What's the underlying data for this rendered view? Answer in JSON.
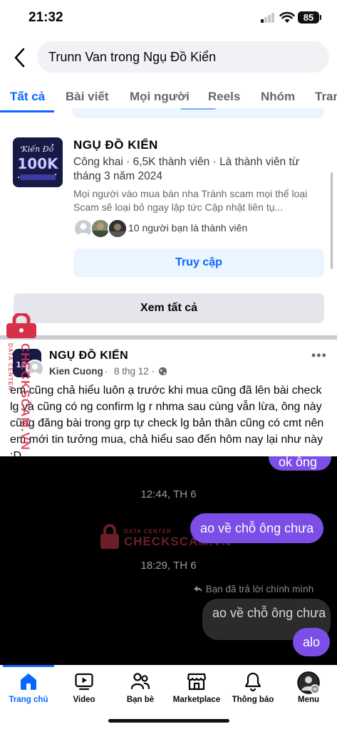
{
  "status_bar": {
    "time": "21:32",
    "battery": "85"
  },
  "search": {
    "query": "Trunn Van trong Ngụ Đồ Kiển"
  },
  "tabs": [
    {
      "label": "Tất cả",
      "active": true
    },
    {
      "label": "Bài viết"
    },
    {
      "label": "Mọi người"
    },
    {
      "label": "Reels"
    },
    {
      "label": "Nhóm"
    },
    {
      "label": "Tran"
    }
  ],
  "group": {
    "thumb_text": "100K",
    "name": "NGỤ ĐỒ KIỂN",
    "meta": "Công khai · 6,5K thành viên · Là thành viên từ tháng 3 năm 2024",
    "description": "Mọi người vào mua bán nha Tránh scam mọi thể loại Scam sẽ loại bỏ ngay lập tức Cập nhật liên tụ...",
    "friends_text": "10 người bạn là thành viên",
    "visit_label": "Truy cập"
  },
  "see_all_label": "Xem tất cả",
  "post": {
    "group_name": "NGỤ ĐỒ KIỂN",
    "author": "Kien Cuong",
    "separator": "·",
    "time": "8 thg 12 ·",
    "text": "em cũng chả hiểu luôn ạ trước khi mua cũng đã lên bài check lg và cũng có ng confirm lg r nhma sau cùng vẫn lừa, ông này cũng đăng bài trong grp tự check lg bản thân cũng có cmt nên em mới tin tưởng mua, chả hiểu sao đến hôm nay lại như này :D"
  },
  "chat": {
    "top_bubble": "ok ông",
    "time_1": "12:44, TH 6",
    "sent_bubble": "ao về chỗ ông chưa",
    "time_2": "18:29, TH 6",
    "reply_note": "Bạn đã trả lời chính mình",
    "quoted_bubble": "ao về chỗ ông chưa",
    "last_bubble": "alo"
  },
  "watermark": {
    "small": "DATA CENTER",
    "big": "CHECKSCAM.VN"
  },
  "nav": [
    {
      "label": "Trang chủ",
      "icon": "home-icon",
      "active": true
    },
    {
      "label": "Video",
      "icon": "video-icon"
    },
    {
      "label": "Bạn bè",
      "icon": "friends-icon"
    },
    {
      "label": "Marketplace",
      "icon": "marketplace-icon"
    },
    {
      "label": "Thông báo",
      "icon": "bell-icon"
    },
    {
      "label": "Menu",
      "icon": "menu-avatar-icon"
    }
  ],
  "colors": {
    "accent": "#0866ff",
    "accent_soft": "#ebf5ff",
    "chat_sent": "#7b4ee8",
    "watermark": "#d93049"
  }
}
